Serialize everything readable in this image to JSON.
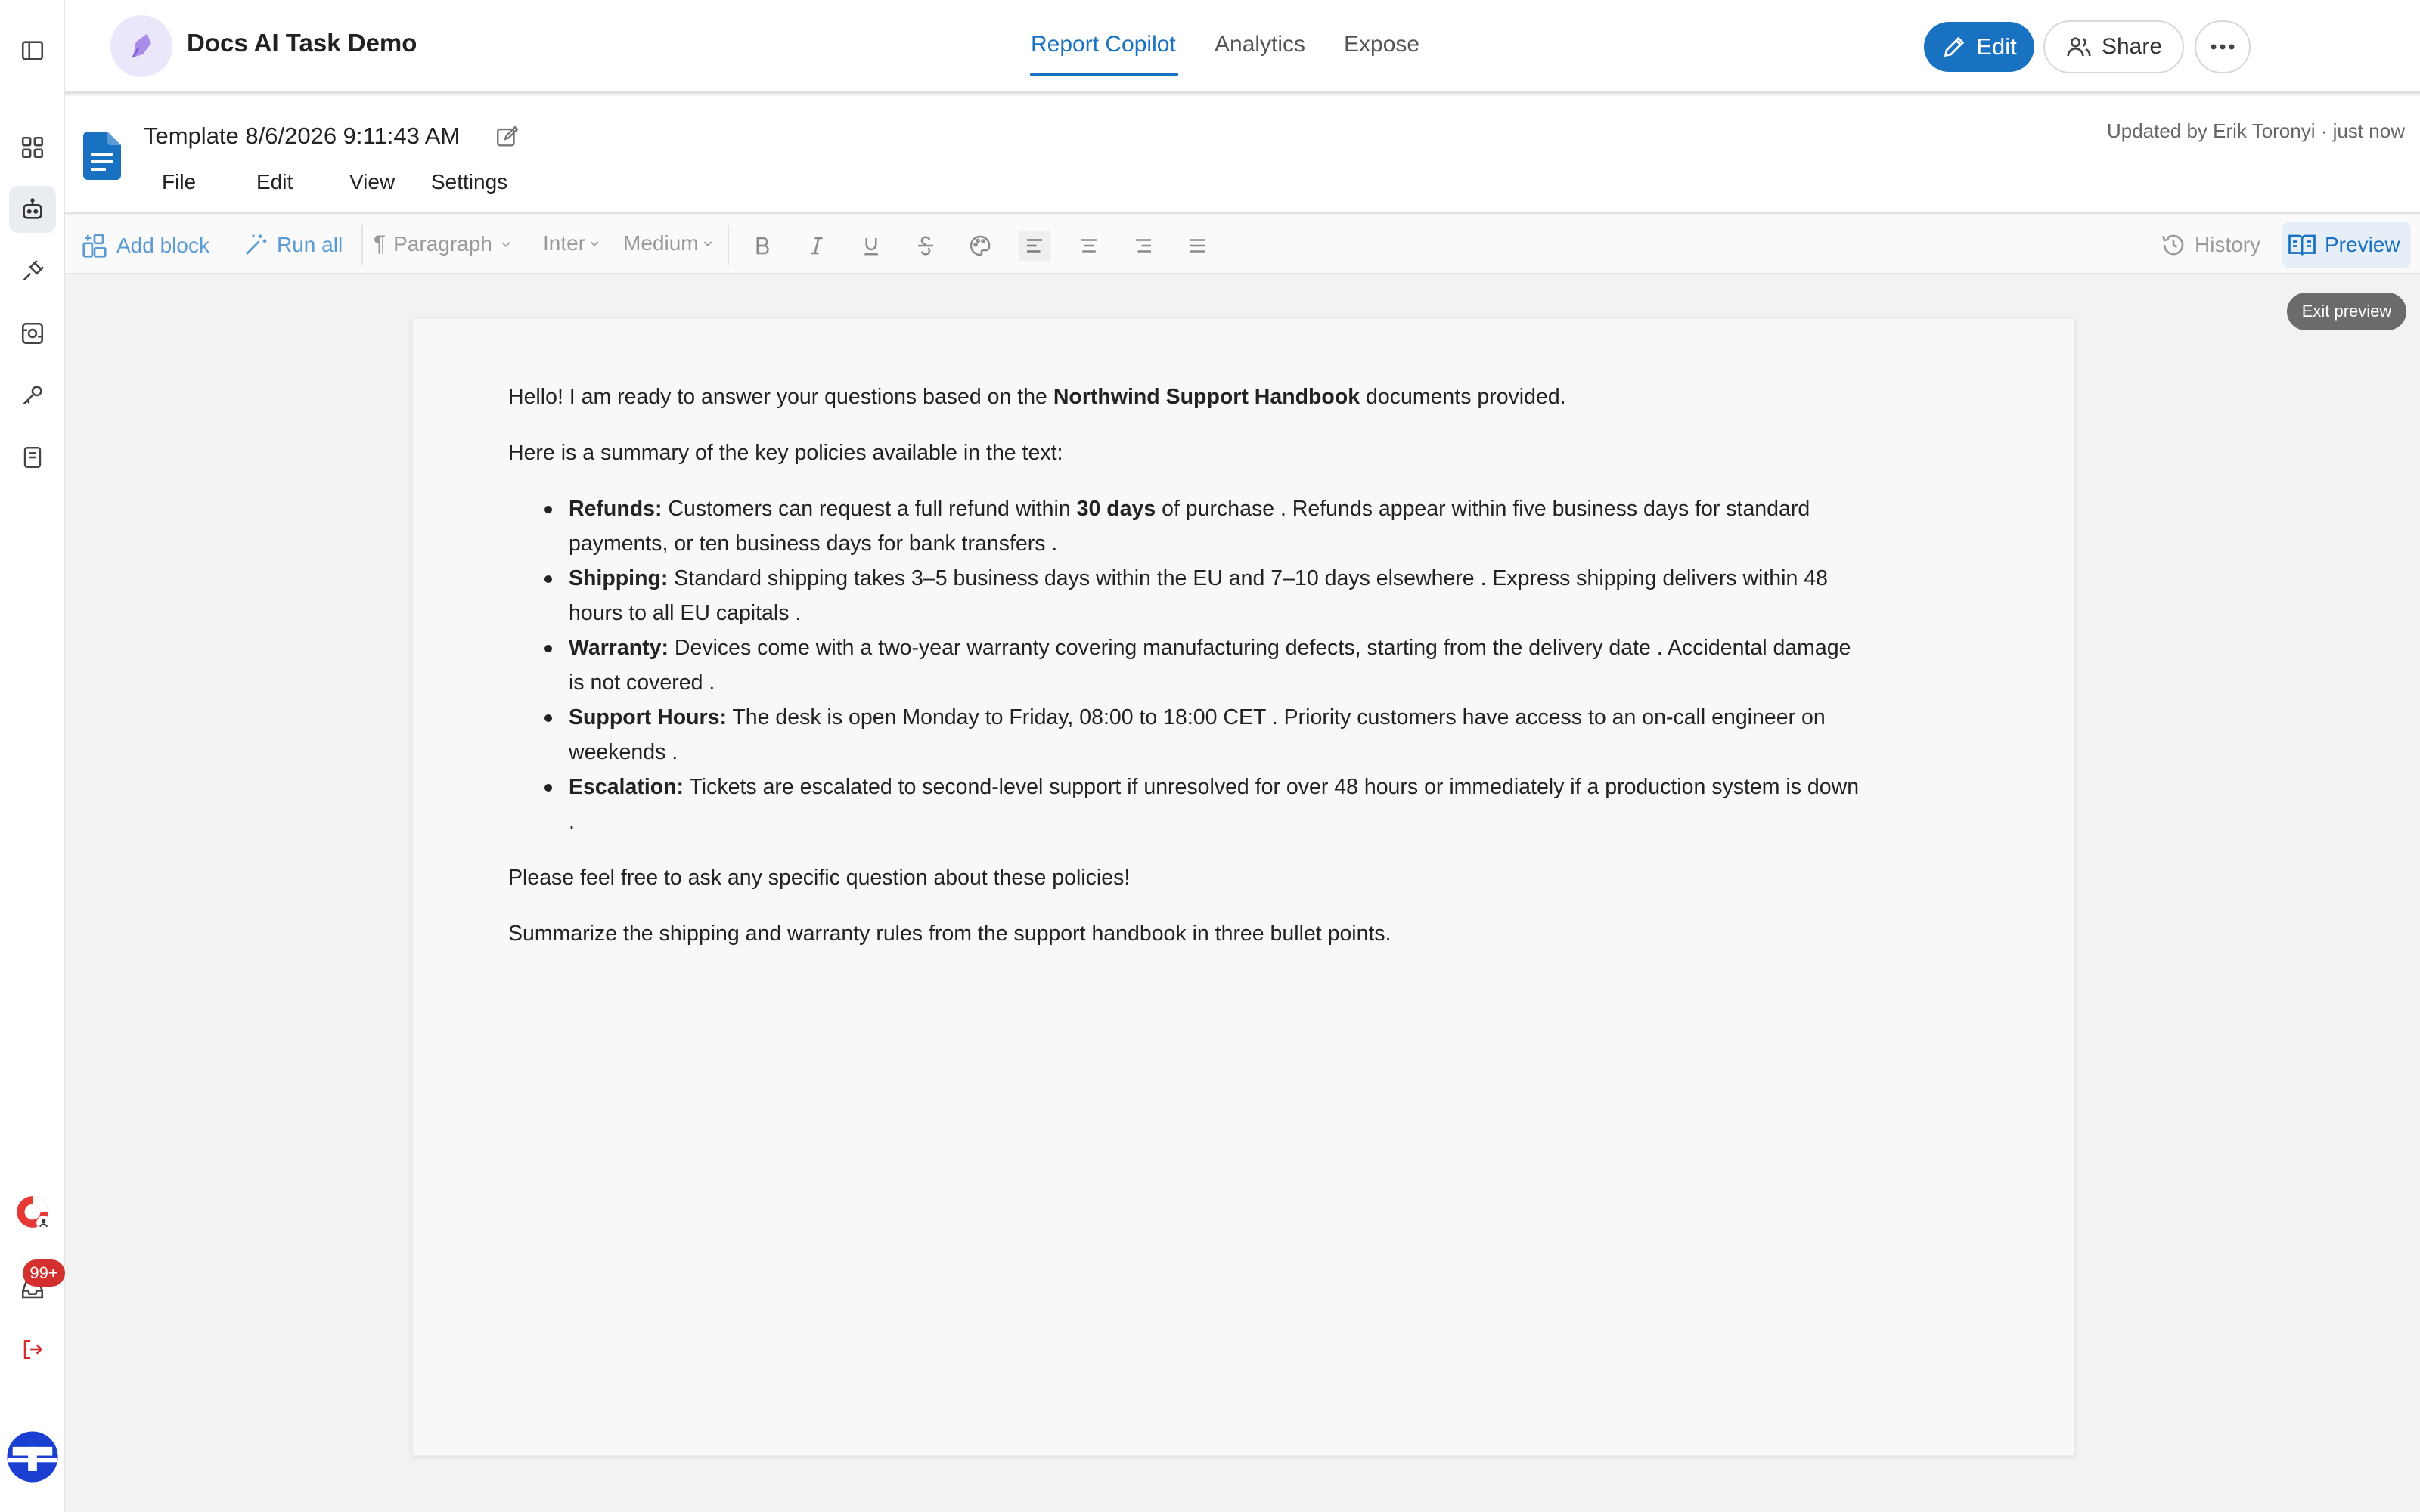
{
  "app": {
    "title": "Docs AI Task Demo"
  },
  "nav_tabs": [
    {
      "label": "Report Copilot",
      "active": true
    },
    {
      "label": "Analytics",
      "active": false
    },
    {
      "label": "Expose",
      "active": false
    }
  ],
  "header_actions": {
    "edit": "Edit",
    "share": "Share"
  },
  "document": {
    "title": "Template 8/6/2026 9:11:43 AM",
    "updated": "Updated by Erik Toronyi · just now",
    "menu": [
      "File",
      "Edit",
      "View",
      "Settings"
    ]
  },
  "toolbar": {
    "add_block": "Add block",
    "run_all": "Run all",
    "paragraph": "Paragraph",
    "font": "Inter",
    "weight": "Medium",
    "history": "History",
    "preview": "Preview",
    "tooltip": "Exit preview"
  },
  "content": {
    "intro_before": "Hello! I am ready to answer your questions based on the ",
    "intro_bold": "Northwind Support Handbook",
    "intro_after": " documents provided.",
    "summary": "Here is a summary of the key policies available in the text:",
    "bullets": [
      {
        "label": "Refunds:",
        "pre": " Customers can request a full refund within ",
        "bold": "30 days",
        "post": " of purchase . Refunds appear within five business days for standard payments, or ten business days for bank transfers ."
      },
      {
        "label": "Shipping:",
        "pre": " Standard shipping takes 3–5 business days within the EU and 7–10 days elsewhere . Express shipping delivers within 48 hours to all EU capitals .",
        "bold": "",
        "post": ""
      },
      {
        "label": "Warranty:",
        "pre": " Devices come with a two-year warranty covering manufacturing defects, starting from the delivery date . Accidental damage is not covered .",
        "bold": "",
        "post": ""
      },
      {
        "label": "Support Hours:",
        "pre": " The desk is open Monday to Friday, 08:00 to 18:00 CET . Priority customers have access to an on-call engineer on weekends .",
        "bold": "",
        "post": ""
      },
      {
        "label": "Escalation:",
        "pre": " Tickets are escalated to second-level support if unresolved for over 48 hours or immediately if a production system is down .",
        "bold": "",
        "post": ""
      }
    ],
    "closing": "Please feel free to ask any specific question about these policies!",
    "prompt": "Summarize the shipping and warranty rules from the support handbook in three bullet points."
  },
  "sidebar": {
    "notification_count": "99+"
  },
  "colors": {
    "accent": "#1971c2",
    "badge": "#d32f2f"
  }
}
